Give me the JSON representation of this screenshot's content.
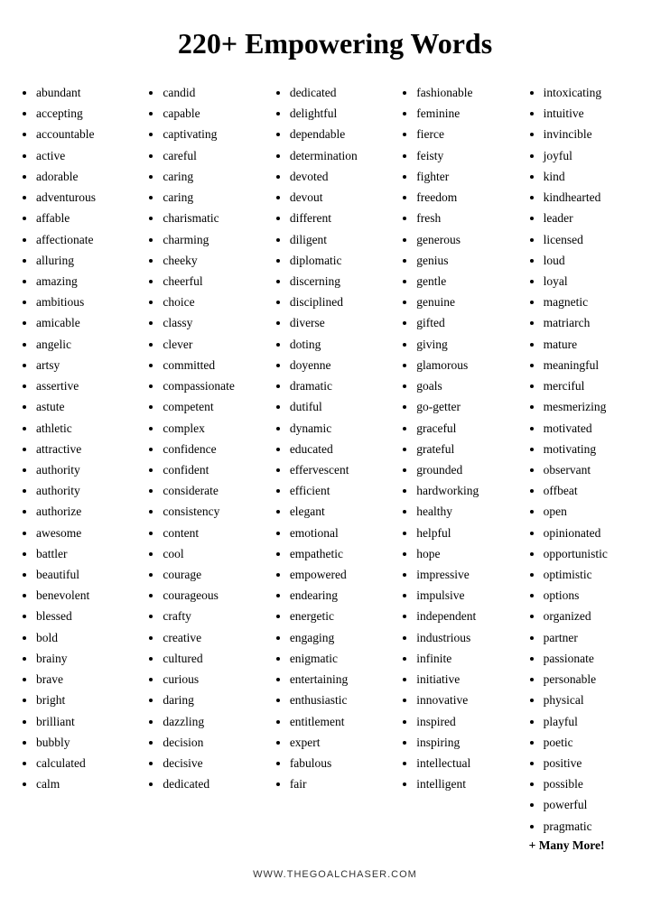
{
  "title": "220+ Empowering Words",
  "columns": [
    {
      "words": [
        "abundant",
        "accepting",
        "accountable",
        "active",
        "adorable",
        "adventurous",
        "affable",
        "affectionate",
        "alluring",
        "amazing",
        "ambitious",
        "amicable",
        "angelic",
        "artsy",
        "assertive",
        "astute",
        "athletic",
        "attractive",
        "authority",
        "authority",
        "authorize",
        "awesome",
        "battler",
        "beautiful",
        "benevolent",
        "blessed",
        "bold",
        "brainy",
        "brave",
        "bright",
        "brilliant",
        "bubbly",
        "calculated",
        "calm"
      ]
    },
    {
      "words": [
        "candid",
        "capable",
        "captivating",
        "careful",
        "caring",
        "caring",
        "charismatic",
        "charming",
        "cheeky",
        "cheerful",
        "choice",
        "classy",
        "clever",
        "committed",
        "compassionate",
        "competent",
        "complex",
        "confidence",
        "confident",
        "considerate",
        "consistency",
        "content",
        "cool",
        "courage",
        "courageous",
        "crafty",
        "creative",
        "cultured",
        "curious",
        "daring",
        "dazzling",
        "decision",
        "decisive",
        "dedicated"
      ]
    },
    {
      "words": [
        "dedicated",
        "delightful",
        "dependable",
        "determination",
        "devoted",
        "devout",
        "different",
        "diligent",
        "diplomatic",
        "discerning",
        "disciplined",
        "diverse",
        "doting",
        "doyenne",
        "dramatic",
        "dutiful",
        "dynamic",
        "educated",
        "effervescent",
        "efficient",
        "elegant",
        "emotional",
        "empathetic",
        "empowered",
        "endearing",
        "energetic",
        "engaging",
        "enigmatic",
        "entertaining",
        "enthusiastic",
        "entitlement",
        "expert",
        "fabulous",
        "fair"
      ]
    },
    {
      "words": [
        "fashionable",
        "feminine",
        "fierce",
        "feisty",
        "fighter",
        "freedom",
        "fresh",
        "generous",
        "genius",
        "gentle",
        "genuine",
        "gifted",
        "giving",
        "glamorous",
        "goals",
        "go-getter",
        "graceful",
        "grateful",
        "grounded",
        "hardworking",
        "healthy",
        "helpful",
        "hope",
        "impressive",
        "impulsive",
        "independent",
        "industrious",
        "infinite",
        "initiative",
        "innovative",
        "inspired",
        "inspiring",
        "intellectual",
        "intelligent"
      ]
    },
    {
      "words": [
        "intoxicating",
        "intuitive",
        "invincible",
        "joyful",
        "kind",
        "kindhearted",
        "leader",
        "licensed",
        "loud",
        "loyal",
        "magnetic",
        "matriarch",
        "mature",
        "meaningful",
        "merciful",
        "mesmerizing",
        "motivated",
        "motivating",
        "observant",
        "offbeat",
        "open",
        "opinionated",
        "opportunistic",
        "optimistic",
        "options",
        "organized",
        "partner",
        "passionate",
        "personable",
        "physical",
        "playful",
        "poetic",
        "positive",
        "possible",
        "powerful",
        "pragmatic"
      ]
    }
  ],
  "more_label": "+ Many More!",
  "footer": "WWW.THEGOALCHASER.COM"
}
